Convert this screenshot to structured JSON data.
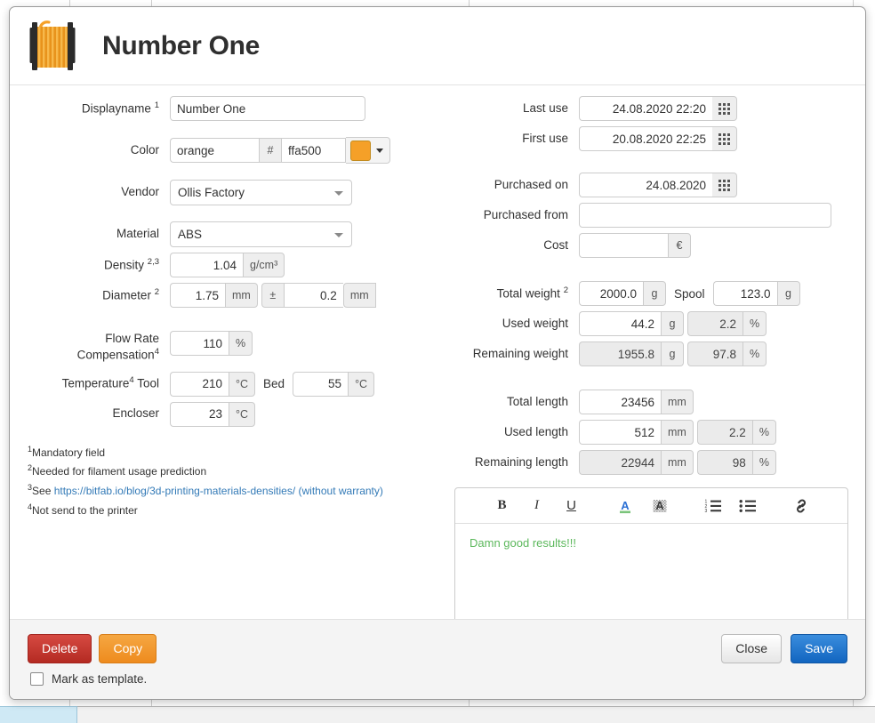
{
  "window": {
    "title": "Number One",
    "spool_icon": "filament-spool-icon"
  },
  "left_form": {
    "displayname": {
      "label": "Displayname",
      "sup": "1",
      "value": "Number One"
    },
    "color": {
      "label": "Color",
      "name_value": "orange",
      "hash": "#",
      "hex_value": "ffa500",
      "swatch_hex": "#f5a028",
      "dropdown_icon": "chevron-down-icon"
    },
    "vendor": {
      "label": "Vendor",
      "value": "Ollis Factory"
    },
    "material": {
      "label": "Material",
      "value": "ABS"
    },
    "density": {
      "label": "Density",
      "sup": "2,3",
      "value": "1.04",
      "unit": "g/cm³"
    },
    "diameter": {
      "label": "Diameter",
      "sup": "2",
      "value": "1.75",
      "unit": "mm",
      "tolerance_symbol": "±",
      "tolerance_value": "0.2",
      "tolerance_unit": "mm"
    },
    "flow_rate": {
      "label_line1": "Flow Rate",
      "label_line2": "Compensation",
      "sup": "4",
      "value": "110",
      "unit": "%"
    },
    "temperature": {
      "label": "Temperature",
      "sup": "4",
      "tool_label": "Tool",
      "tool_value": "210",
      "tool_unit": "°C",
      "bed_label": "Bed",
      "bed_value": "55",
      "bed_unit": "°C"
    },
    "encloser": {
      "label": "Encloser",
      "value": "23",
      "unit": "°C"
    }
  },
  "footnotes": [
    {
      "marker": "1",
      "text": "Mandatory field"
    },
    {
      "marker": "2",
      "text": "Needed for filament usage prediction"
    },
    {
      "marker": "3",
      "text_before": "See ",
      "link": "https://bitfab.io/blog/3d-printing-materials-densities/",
      "text_after": " (without warranty)"
    },
    {
      "marker": "4",
      "text": "Not send to the printer"
    }
  ],
  "right_form": {
    "last_use": {
      "label": "Last use",
      "value": "24.08.2020 22:20",
      "icon": "calendar-icon"
    },
    "first_use": {
      "label": "First use",
      "value": "20.08.2020 22:25",
      "icon": "calendar-icon"
    },
    "purchased_on": {
      "label": "Purchased on",
      "value": "24.08.2020",
      "icon": "calendar-icon"
    },
    "purchased_from": {
      "label": "Purchased from",
      "value": ""
    },
    "cost": {
      "label": "Cost",
      "value": "",
      "unit": "€"
    },
    "total_weight": {
      "label": "Total weight",
      "sup": "2",
      "value": "2000.0",
      "unit": "g",
      "spool_label": "Spool",
      "spool_value": "123.0",
      "spool_unit": "g"
    },
    "used_weight": {
      "label": "Used weight",
      "value": "44.2",
      "unit": "g",
      "percent_value": "2.2",
      "percent_unit": "%"
    },
    "remaining_weight": {
      "label": "Remaining weight",
      "value": "1955.8",
      "unit": "g",
      "percent_value": "97.8",
      "percent_unit": "%"
    },
    "total_length": {
      "label": "Total length",
      "value": "23456",
      "unit": "mm"
    },
    "used_length": {
      "label": "Used length",
      "value": "512",
      "unit": "mm",
      "percent_value": "2.2",
      "percent_unit": "%"
    },
    "remaining_length": {
      "label": "Remaining length",
      "value": "22944",
      "unit": "mm",
      "percent_value": "98",
      "percent_unit": "%"
    }
  },
  "editor": {
    "toolbar": [
      {
        "name": "bold-icon",
        "glyph": "B"
      },
      {
        "name": "italic-icon",
        "glyph": "I"
      },
      {
        "name": "underline-icon",
        "glyph": "U"
      },
      {
        "name": "text-color-icon",
        "glyph": "A"
      },
      {
        "name": "highlight-color-icon",
        "glyph": "A"
      },
      {
        "name": "ordered-list-icon",
        "glyph": "≔"
      },
      {
        "name": "unordered-list-icon",
        "glyph": "≡"
      },
      {
        "name": "link-icon",
        "glyph": "🔗"
      }
    ],
    "content": "Damn good results!!!",
    "content_color": "#5cb85c",
    "text_color_accent": "#2a6fd4",
    "text_color_underline": "#7bc47b"
  },
  "footer": {
    "delete_label": "Delete",
    "copy_label": "Copy",
    "close_label": "Close",
    "save_label": "Save",
    "template_checkbox_label": "Mark as template.",
    "template_checked": false
  }
}
